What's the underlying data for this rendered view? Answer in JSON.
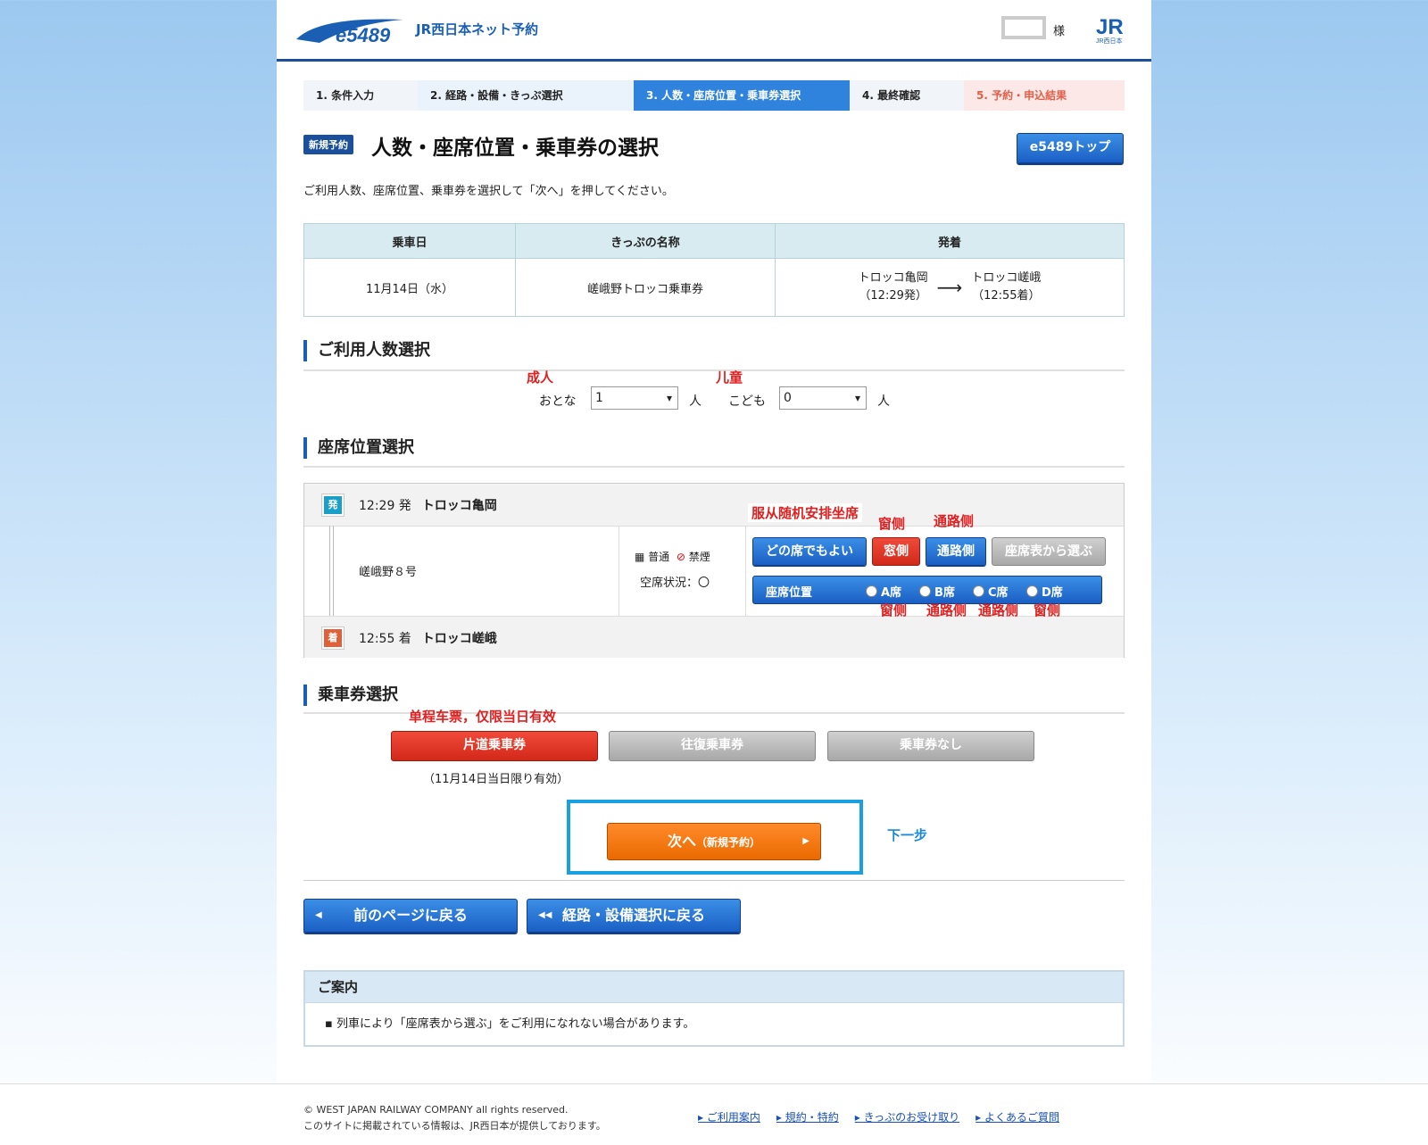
{
  "header": {
    "logo_text": "e5489",
    "service_name": "JR西日本ネット予約",
    "user_suffix": "様",
    "jr_logo_text": "JR西日本"
  },
  "steps": [
    "1. 条件入力",
    "2. 経路・設備・きっぷ選択",
    "3. 人数・座席位置・乗車券選択",
    "4. 最終確認",
    "5. 予約・申込結果"
  ],
  "title_badge": "新規予約",
  "title": "人数・座席位置・乗車券の選択",
  "top_button": "e5489トップ",
  "intro": "ご利用人数、座席位置、乗車券を選択して「次へ」を押してください。",
  "info_table": {
    "headers": [
      "乗車日",
      "きっぷの名称",
      "発着"
    ],
    "date": "11月14日（水）",
    "ticket_name": "嵯峨野トロッコ乗車券",
    "from_station": "トロッコ亀岡",
    "from_time": "（12:29発）",
    "arrow": "⟶",
    "to_station": "トロッコ嵯峨",
    "to_time": "（12:55着）"
  },
  "people": {
    "section_title": "ご利用人数選択",
    "adult_note": "成人",
    "child_note": "儿童",
    "adult_label": "おとな",
    "adult_value": "1",
    "adult_unit": "人",
    "child_label": "こども",
    "child_value": "0",
    "child_unit": "人"
  },
  "seat": {
    "section_title": "座席位置選択",
    "dep_tag": "発",
    "dep_time": "12:29 発",
    "dep_station": "トロッコ亀岡",
    "arr_tag": "着",
    "arr_time": "12:55 着",
    "arr_station": "トロッコ嵯峨",
    "train_name": "嵯峨野８号",
    "car_type": "普通",
    "smoking": "禁煙",
    "vacancy_label": "空席状況：",
    "vacancy_value": "〇",
    "buttons": [
      "どの席でもよい",
      "窓側",
      "通路側",
      "座席表から選ぶ"
    ],
    "position_label": "座席位置",
    "seats": [
      "A席",
      "B席",
      "C席",
      "D席"
    ],
    "note_random": "服从随机安排坐席",
    "note_window": "窗侧",
    "note_aisle": "通路侧",
    "seat_notes": [
      "窗侧",
      "通路侧",
      "通路侧",
      "窗侧"
    ]
  },
  "ticket": {
    "section_title": "乗車券選択",
    "note": "单程车票，仅限当日有效",
    "options": [
      "片道乗車券",
      "往復乗車券",
      "乗車券なし"
    ],
    "validity": "（11月14日当日限り有効）"
  },
  "next": {
    "label": "次へ",
    "sub": "（新規予約）",
    "side_note": "下一步"
  },
  "back_buttons": [
    "前のページに戻る",
    "経路・設備選択に戻る"
  ],
  "guide": {
    "title": "ご案内",
    "text": "▪ 列車により「座席表から選ぶ」をご利用になれない場合があります。"
  },
  "footer": {
    "copyright": "© WEST JAPAN RAILWAY COMPANY all rights reserved.",
    "notice": "このサイトに掲載されている情報は、JR西日本が提供しております。",
    "links": [
      "ご利用案内",
      "規約・特約",
      "きっぷのお受け取り",
      "よくあるご質問"
    ]
  },
  "colors": {
    "brand_blue": "#1a5fc4",
    "active_step": "#2f83dd",
    "selected_red": "#d2281a",
    "next_orange": "#ea6a00",
    "annotation_red": "#e02020"
  }
}
